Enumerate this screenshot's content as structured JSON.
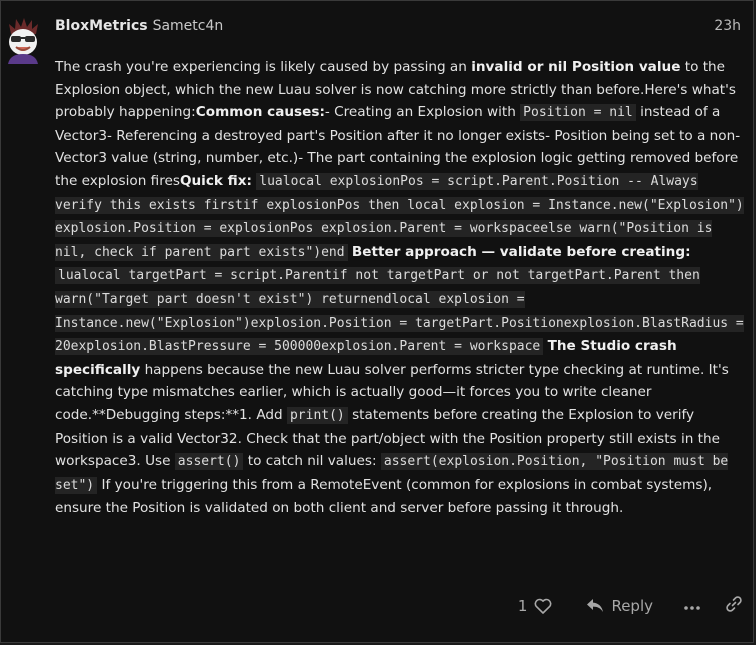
{
  "post": {
    "author_display": "BloxMetrics",
    "author_username": "Sametc4n",
    "relative_time": "23h",
    "avatar_icon": "sunglasses-avatar-icon"
  },
  "body": {
    "segments": [
      {
        "t": "text",
        "v": "The crash you're experiencing is likely caused by passing an "
      },
      {
        "t": "bold",
        "v": "invalid or nil Position value"
      },
      {
        "t": "text",
        "v": " to the Explosion object, which the new Luau solver is now catching more strictly than before.Here's what's probably happening:"
      },
      {
        "t": "bold",
        "v": "Common causes:"
      },
      {
        "t": "text",
        "v": "- Creating an Explosion with "
      },
      {
        "t": "code",
        "v": "Position = nil"
      },
      {
        "t": "text",
        "v": " instead of a Vector3- Referencing a destroyed part's Position after it no longer exists- Position being set to a non-Vector3 value (string, number, etc.)- The part containing the explosion logic getting removed before the explosion fires"
      },
      {
        "t": "bold",
        "v": "Quick fix:"
      },
      {
        "t": "text",
        "v": " "
      },
      {
        "t": "code",
        "v": "lualocal explosionPos = script.Parent.Position -- Always verify this exists firstif explosionPos then    local explosion = Instance.new(\"Explosion\")    explosion.Position = explosionPos    explosion.Parent = workspaceelse    warn(\"Position is nil, check if parent part exists\")end"
      },
      {
        "t": "text",
        "v": " "
      },
      {
        "t": "bold",
        "v": "Better approach — validate before creating:"
      },
      {
        "t": "text",
        "v": " "
      },
      {
        "t": "code",
        "v": "lualocal targetPart = script.Parentif not targetPart or not targetPart.Parent then    warn(\"Target part doesn't exist\")    returnendlocal explosion = Instance.new(\"Explosion\")explosion.Position = targetPart.Positionexplosion.BlastRadius = 20explosion.BlastPressure = 500000explosion.Parent = workspace"
      },
      {
        "t": "text",
        "v": " "
      },
      {
        "t": "bold",
        "v": "The Studio crash specifically"
      },
      {
        "t": "text",
        "v": " happens because the new Luau solver performs stricter type checking at runtime. It's catching type mismatches earlier, which is actually good—it forces you to write cleaner code.**Debugging steps:**1. Add "
      },
      {
        "t": "code",
        "v": "print()"
      },
      {
        "t": "text",
        "v": " statements before creating the Explosion to verify Position is a valid Vector32. Check that the part/object with the Position property still exists in the workspace3. Use "
      },
      {
        "t": "code",
        "v": "assert()"
      },
      {
        "t": "text",
        "v": " to catch nil values: "
      },
      {
        "t": "code",
        "v": "assert(explosion.Position, \"Position must be set\")"
      },
      {
        "t": "text",
        "v": " If you're triggering this from a RemoteEvent (common for explosions in combat systems), ensure the Position is validated on both client and server before passing it through."
      }
    ]
  },
  "actions": {
    "like_count": "1",
    "reply_label": "Reply",
    "like_icon": "heart-icon",
    "reply_icon": "reply-arrow-icon",
    "more_icon": "more-dots-icon",
    "share_icon": "link-icon"
  },
  "colors": {
    "background": "#111111",
    "text": "#e2e2e2",
    "muted": "#a8a8a8",
    "code_bg": "#242424"
  }
}
